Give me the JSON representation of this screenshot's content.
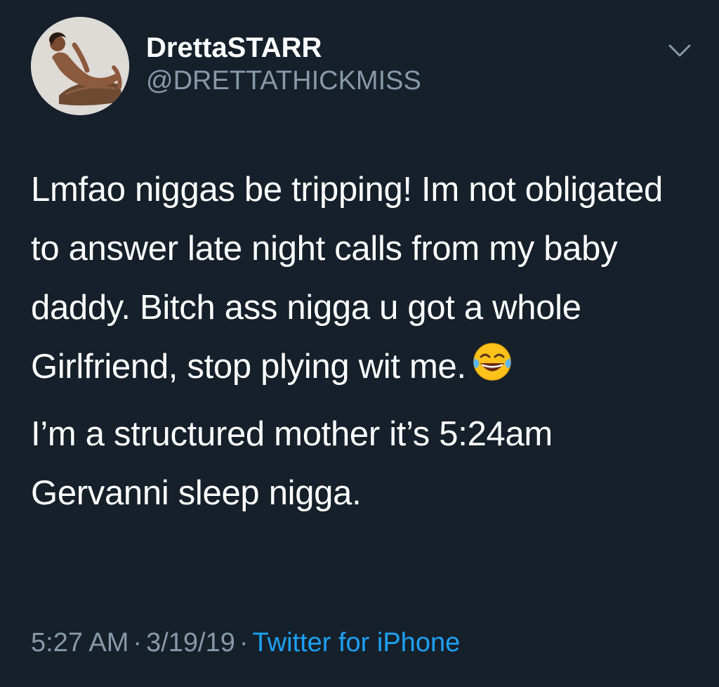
{
  "user": {
    "display_name": "DrettaSTARR",
    "handle": "@DRETTATHICKMISS"
  },
  "tweet": {
    "paragraphs": [
      "Lmfao niggas be tripping! Im not obligated to answer late night calls from my baby daddy. Bitch ass nigga u got a whole Girlfriend, stop plying wit me.",
      "I’m a structured mother it’s 5:24am Gervanni sleep nigga."
    ],
    "emoji": "face-with-tears-of-joy"
  },
  "meta": {
    "time": "5:27 AM",
    "date": "3/19/19",
    "separator": "·",
    "source": "Twitter for iPhone"
  },
  "icons": {
    "menu": "chevron-down-icon",
    "avatar": "profile-photo"
  },
  "colors": {
    "background": "#15202b",
    "text": "#ffffff",
    "secondary": "#8899a6",
    "link": "#1da1f2"
  }
}
